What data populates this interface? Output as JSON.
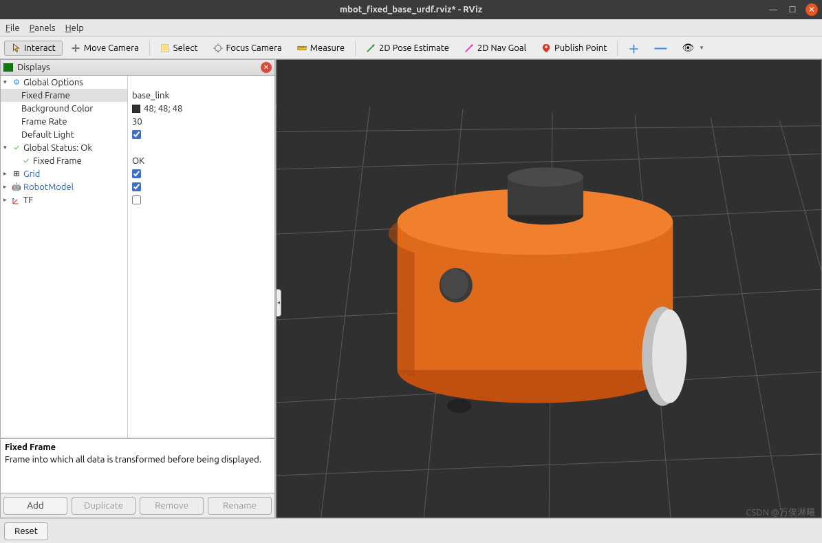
{
  "window": {
    "title": "mbot_fixed_base_urdf.rviz* - RViz"
  },
  "menu": {
    "file": "File",
    "panels": "Panels",
    "help": "Help"
  },
  "toolbar": {
    "interact": "Interact",
    "move_camera": "Move Camera",
    "select": "Select",
    "focus_camera": "Focus Camera",
    "measure": "Measure",
    "pose_estimate": "2D Pose Estimate",
    "nav_goal": "2D Nav Goal",
    "publish_point": "Publish Point"
  },
  "panel": {
    "title": "Displays"
  },
  "tree": {
    "global_options": "Global Options",
    "fixed_frame": "Fixed Frame",
    "fixed_frame_val": "base_link",
    "background_color": "Background Color",
    "background_color_val": "48; 48; 48",
    "frame_rate": "Frame Rate",
    "frame_rate_val": "30",
    "default_light": "Default Light",
    "global_status": "Global Status: Ok",
    "status_fixed_frame": "Fixed Frame",
    "status_fixed_frame_val": "OK",
    "grid": "Grid",
    "robot_model": "RobotModel",
    "tf": "TF"
  },
  "desc": {
    "title": "Fixed Frame",
    "text": "Frame into which all data is transformed before being displayed."
  },
  "buttons": {
    "add": "Add",
    "duplicate": "Duplicate",
    "remove": "Remove",
    "rename": "Rename",
    "reset": "Reset"
  },
  "watermark": "CSDN @万俟淋曦"
}
